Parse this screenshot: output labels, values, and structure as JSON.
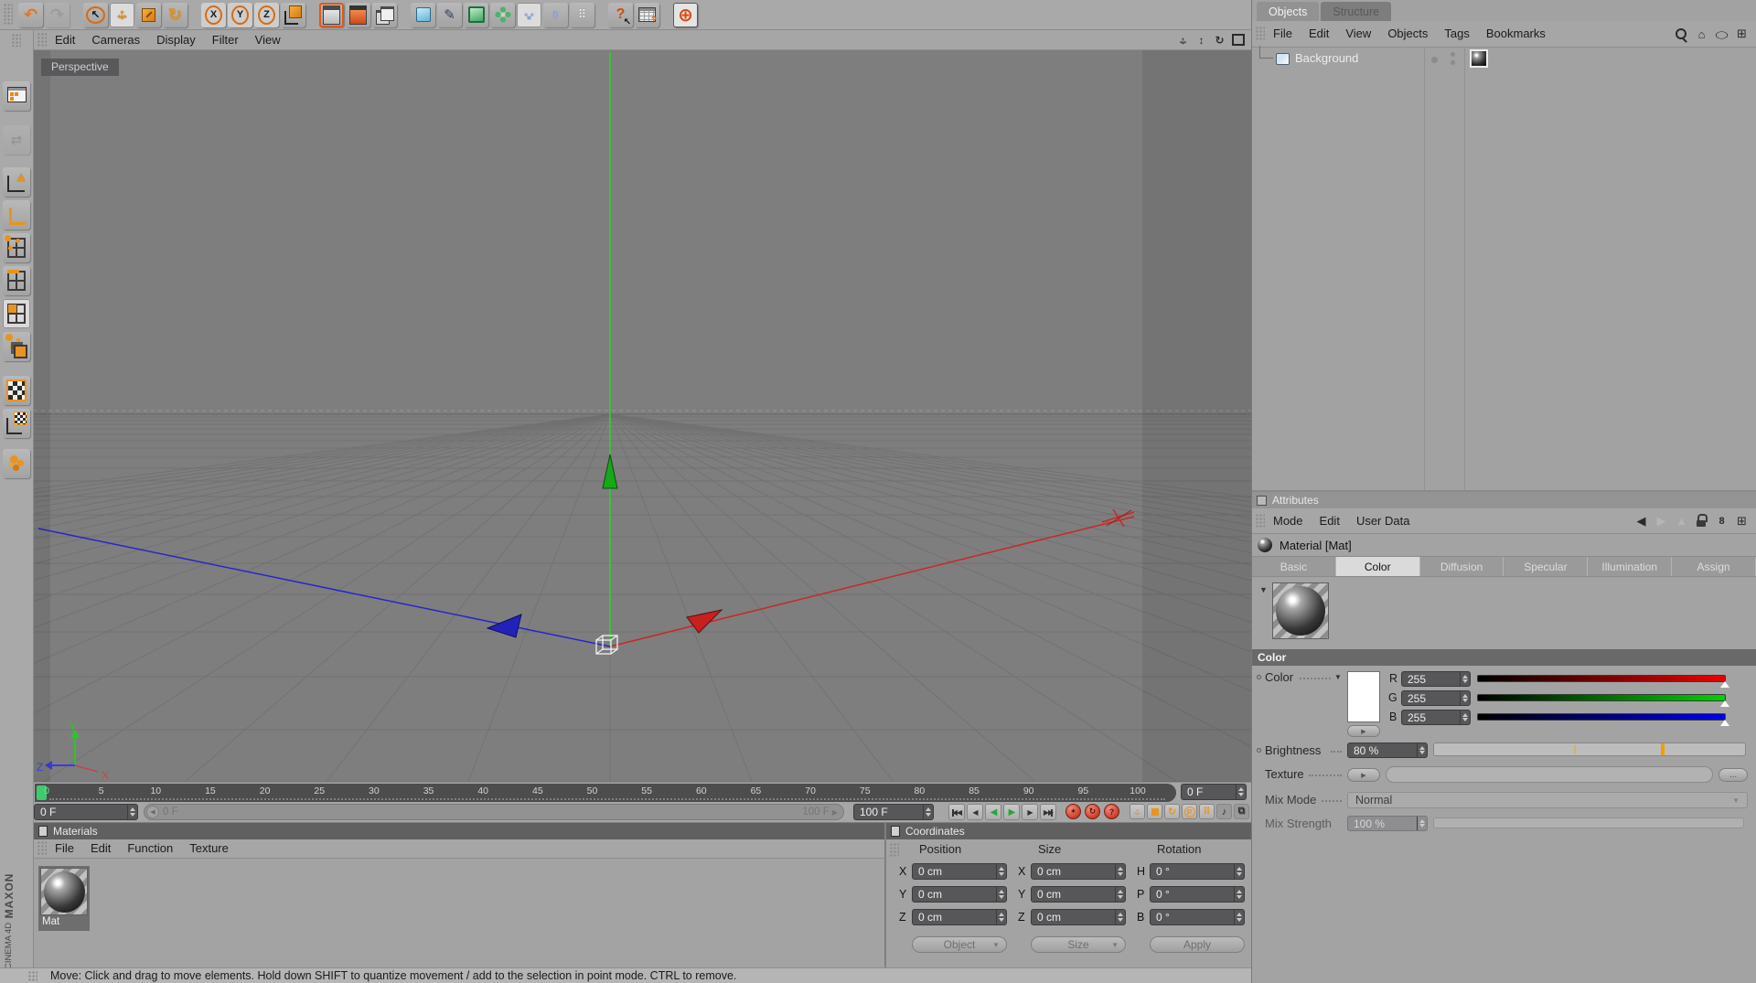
{
  "colors": {
    "accent_orange": "#e8941f",
    "selected_orange": "#e05818",
    "axis_red": "#cc2626",
    "axis_green": "#2bd42b",
    "axis_blue": "#2626cc",
    "record_red": "#cc3a28",
    "frame_green": "#3ecb6b"
  },
  "top_toolbar": {
    "buttons": [
      {
        "name": "undo",
        "glyph": "↶"
      },
      {
        "name": "redo",
        "glyph": "↷",
        "disabled": true
      },
      {
        "name": "live-selection",
        "glyph": "↖",
        "group": true
      },
      {
        "name": "move",
        "active": true
      },
      {
        "name": "scale"
      },
      {
        "name": "rotate",
        "glyph": "↻"
      },
      {
        "name": "lock-x",
        "glyph": "X",
        "group": true,
        "lightbg": true
      },
      {
        "name": "lock-y",
        "glyph": "Y",
        "lightbg": true
      },
      {
        "name": "lock-z",
        "glyph": "Z",
        "lightbg": true
      },
      {
        "name": "coordinate-system"
      },
      {
        "name": "render-view",
        "group": true,
        "selected": true
      },
      {
        "name": "render-settings"
      },
      {
        "name": "render-queue"
      },
      {
        "name": "add-primitive",
        "group": true
      },
      {
        "name": "add-spline",
        "glyph": "✎"
      },
      {
        "name": "add-hypernurbs"
      },
      {
        "name": "add-array"
      },
      {
        "name": "add-expand",
        "active": true
      },
      {
        "name": "add-deformer",
        "glyph": "◗"
      },
      {
        "name": "add-particles",
        "glyph": "⠿"
      },
      {
        "name": "help",
        "glyph": "?",
        "group": true
      },
      {
        "name": "xpresso"
      },
      {
        "name": "online-updater",
        "glyph": "⊕",
        "group": true,
        "boxed": true
      }
    ]
  },
  "left_toolbar": {
    "buttons": [
      {
        "name": "layout"
      },
      {
        "name": "convert",
        "glyph": "⇄",
        "disabled": true
      },
      {
        "name": "model-mode"
      },
      {
        "name": "object-axis-mode"
      },
      {
        "name": "point-mode",
        "grid": true
      },
      {
        "name": "edge-mode",
        "grid": true
      },
      {
        "name": "polygon-mode",
        "grid": true,
        "active": true
      },
      {
        "name": "uv-mode"
      },
      {
        "name": "texture-mode"
      },
      {
        "name": "texture-axis-mode"
      },
      {
        "name": "object-library"
      }
    ]
  },
  "viewport": {
    "menu": [
      "Edit",
      "Cameras",
      "Display",
      "Filter",
      "View"
    ],
    "label": "Perspective",
    "view_icons": [
      {
        "name": "pan-view"
      },
      {
        "name": "zoom-view",
        "glyph": "↕"
      },
      {
        "name": "rotate-view",
        "glyph": "↻"
      },
      {
        "name": "maximize-view"
      }
    ],
    "axis_gizmo": {
      "x": "X",
      "y": "Y",
      "z": "Z"
    }
  },
  "timeline": {
    "ticks": [
      "0",
      "5",
      "10",
      "15",
      "20",
      "25",
      "30",
      "35",
      "40",
      "45",
      "50",
      "55",
      "60",
      "65",
      "70",
      "75",
      "80",
      "85",
      "90",
      "95",
      "100"
    ],
    "current_frame": "0 F",
    "frame_field": "0 F",
    "range_start": "0 F",
    "range_end": "100 F",
    "end_frame": "100 F",
    "transport": [
      {
        "name": "goto-start",
        "glyph": "◀◀",
        "bar": "b1"
      },
      {
        "name": "previous-key",
        "glyph": "◀"
      },
      {
        "name": "play-backward",
        "glyph": "◀",
        "green": true
      },
      {
        "name": "play-forward",
        "glyph": "▶",
        "green": true
      },
      {
        "name": "next-key",
        "glyph": "▶"
      },
      {
        "name": "goto-end",
        "glyph": "▶▶",
        "bar": "b2"
      }
    ],
    "record_buttons": [
      {
        "name": "record-keyframe",
        "glyph": "✶"
      },
      {
        "name": "autokey",
        "glyph": "↻"
      },
      {
        "name": "record-options",
        "glyph": "?"
      }
    ],
    "key_toggles": [
      {
        "name": "key-position"
      },
      {
        "name": "key-scale"
      },
      {
        "name": "key-rotation",
        "glyph": "↻"
      },
      {
        "name": "key-parameter",
        "glyph": "P",
        "circle": true
      },
      {
        "name": "key-pla",
        "glyph": "⠿"
      },
      {
        "name": "sound",
        "glyph": "♪",
        "dark": true
      },
      {
        "name": "keyframe-selection",
        "glyph": "⧉",
        "dark": true
      }
    ]
  },
  "materials_panel": {
    "title": "Materials",
    "menu": [
      "File",
      "Edit",
      "Function",
      "Texture"
    ],
    "items": [
      {
        "label": "Mat"
      }
    ]
  },
  "coordinates_panel": {
    "title": "Coordinates",
    "columns": [
      {
        "header": "Position",
        "rows": [
          {
            "label": "X",
            "value": "0 cm"
          },
          {
            "label": "Y",
            "value": "0 cm"
          },
          {
            "label": "Z",
            "value": "0 cm"
          }
        ]
      },
      {
        "header": "Size",
        "rows": [
          {
            "label": "X",
            "value": "0 cm"
          },
          {
            "label": "Y",
            "value": "0 cm"
          },
          {
            "label": "Z",
            "value": "0 cm"
          }
        ]
      },
      {
        "header": "Rotation",
        "rows": [
          {
            "label": "H",
            "value": "0 °"
          },
          {
            "label": "P",
            "value": "0 °"
          },
          {
            "label": "B",
            "value": "0 °"
          }
        ]
      }
    ],
    "footer_buttons": [
      {
        "label": "Object",
        "dropdown": true
      },
      {
        "label": "Size",
        "dropdown": true
      },
      {
        "label": "Apply",
        "dropdown": false
      }
    ]
  },
  "objects_panel": {
    "tabs": [
      {
        "label": "Objects",
        "active": true
      },
      {
        "label": "Structure",
        "active": false
      }
    ],
    "menu": [
      "File",
      "Edit",
      "View",
      "Objects",
      "Tags",
      "Bookmarks"
    ],
    "icons": [
      {
        "name": "find"
      },
      {
        "name": "home",
        "glyph": "⌂"
      },
      {
        "name": "filter",
        "glyph": "◯"
      },
      {
        "name": "add-panel",
        "glyph": "⊞"
      }
    ],
    "tree": [
      {
        "label": "Background"
      }
    ]
  },
  "attributes_panel": {
    "title": "Attributes",
    "menu": [
      "Mode",
      "Edit",
      "User Data"
    ],
    "icons": [
      {
        "name": "history-back",
        "glyph": "◀"
      },
      {
        "name": "history-forward",
        "glyph": "▶",
        "disabled": true
      },
      {
        "name": "pin",
        "glyph": "▲",
        "disabled": true
      },
      {
        "name": "lock"
      },
      {
        "name": "link",
        "glyph": "8"
      },
      {
        "name": "add-panel",
        "glyph": "⊞"
      }
    ],
    "object_title": "Material [Mat]",
    "tabs": [
      "Basic",
      "Color",
      "Diffusion",
      "Specular",
      "Illumination",
      "Assign"
    ],
    "active_tab": "Color",
    "section_header": "Color",
    "color": {
      "label": "Color",
      "r_label": "R",
      "g_label": "G",
      "b_label": "B",
      "r": "255",
      "g": "255",
      "b": "255"
    },
    "brightness": {
      "label": "Brightness",
      "value": "80 %"
    },
    "texture": {
      "label": "Texture",
      "value": "",
      "browse_label": "..."
    },
    "mix_mode": {
      "label": "Mix Mode",
      "value": "Normal"
    },
    "mix_strength": {
      "label": "Mix Strength",
      "value": "100 %"
    }
  },
  "status_bar": {
    "text": "Move: Click and drag to move elements. Hold down SHIFT to quantize movement / add to the selection in point mode. CTRL to remove."
  },
  "branding": {
    "line1": "MAXON",
    "line2": "CINEMA 4D"
  }
}
